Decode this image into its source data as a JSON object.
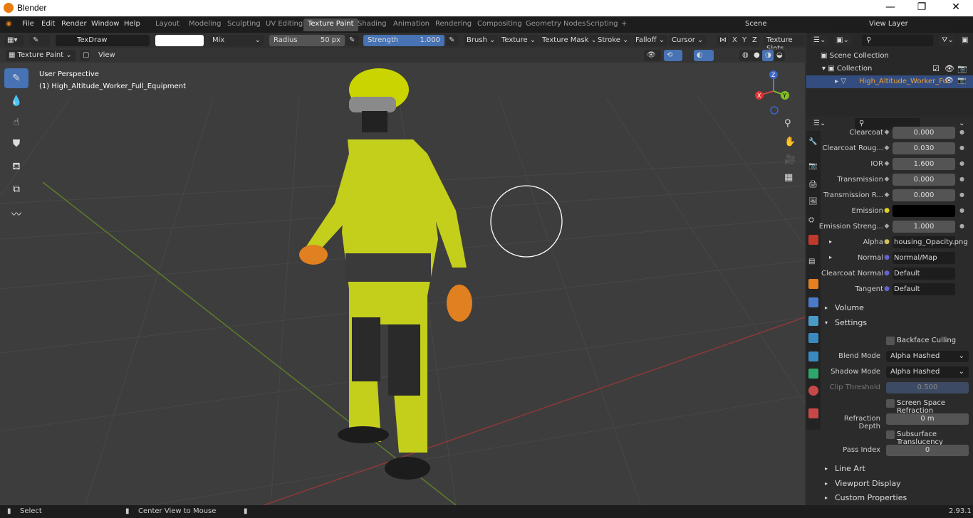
{
  "window": {
    "title": "Blender",
    "min": "—",
    "restore": "❐",
    "close": "✕"
  },
  "menu": [
    "File",
    "Edit",
    "Render",
    "Window",
    "Help"
  ],
  "workspaces": [
    "Layout",
    "Modeling",
    "Sculpting",
    "UV Editing",
    "Texture Paint",
    "Shading",
    "Animation",
    "Rendering",
    "Compositing",
    "Geometry Nodes",
    "Scripting"
  ],
  "active_workspace": "Texture Paint",
  "scene": "Scene",
  "view_layer": "View Layer",
  "tool": {
    "brush_name": "TexDraw",
    "blend": "Mix",
    "radius_label": "Radius",
    "radius_value": "50 px",
    "strength_label": "Strength",
    "strength_value": "1.000",
    "dropdowns": [
      "Brush",
      "Texture",
      "Texture Mask",
      "Stroke",
      "Falloff",
      "Cursor"
    ],
    "axes": [
      "X",
      "Y",
      "Z"
    ],
    "texture_slots": "Texture Slots"
  },
  "mode": "Texture Paint",
  "view_menu": "View",
  "viewport": {
    "perspective": "User Perspective",
    "object": "(1) High_Altitude_Worker_Full_Equipment",
    "gizmo": {
      "x": "X",
      "y": "Y",
      "z": "Z"
    }
  },
  "outliner": {
    "root": "Scene Collection",
    "collection": "Collection",
    "object": "High_Altitude_Worker_Fu"
  },
  "properties": [
    {
      "label": "Clearcoat",
      "value": "0.000"
    },
    {
      "label": "Clearcoat Roug...",
      "value": "0.030"
    },
    {
      "label": "IOR",
      "value": "1.600"
    },
    {
      "label": "Transmission",
      "value": "0.000"
    },
    {
      "label": "Transmission R...",
      "value": "0.000"
    },
    {
      "label": "Emission",
      "value": ""
    },
    {
      "label": "Emission Streng...",
      "value": "1.000"
    },
    {
      "label": "Alpha",
      "value": "housing_Opacity.png"
    },
    {
      "label": "Normal",
      "value": "Normal/Map"
    },
    {
      "label": "Clearcoat Normal",
      "value": "Default"
    },
    {
      "label": "Tangent",
      "value": "Default"
    }
  ],
  "panels": {
    "volume": "Volume",
    "settings": "Settings",
    "line_art": "Line Art",
    "viewport_display": "Viewport Display",
    "custom_properties": "Custom Properties"
  },
  "settings": {
    "backface": "Backface Culling",
    "blend_mode_label": "Blend Mode",
    "blend_mode": "Alpha Hashed",
    "shadow_mode_label": "Shadow Mode",
    "shadow_mode": "Alpha Hashed",
    "clip_label": "Clip Threshold",
    "clip_value": "0.500",
    "ssr": "Screen Space Refraction",
    "refraction_label": "Refraction Depth",
    "refraction_value": "0 m",
    "sss": "Subsurface Translucency",
    "pass_label": "Pass Index",
    "pass_value": "0"
  },
  "status": {
    "select": "Select",
    "center": "Center View to Mouse",
    "version": "2.93.1"
  },
  "colors": {
    "accent": "#4772b3",
    "active_obj": "#f0a030",
    "hi_vis": "#d4e000"
  }
}
